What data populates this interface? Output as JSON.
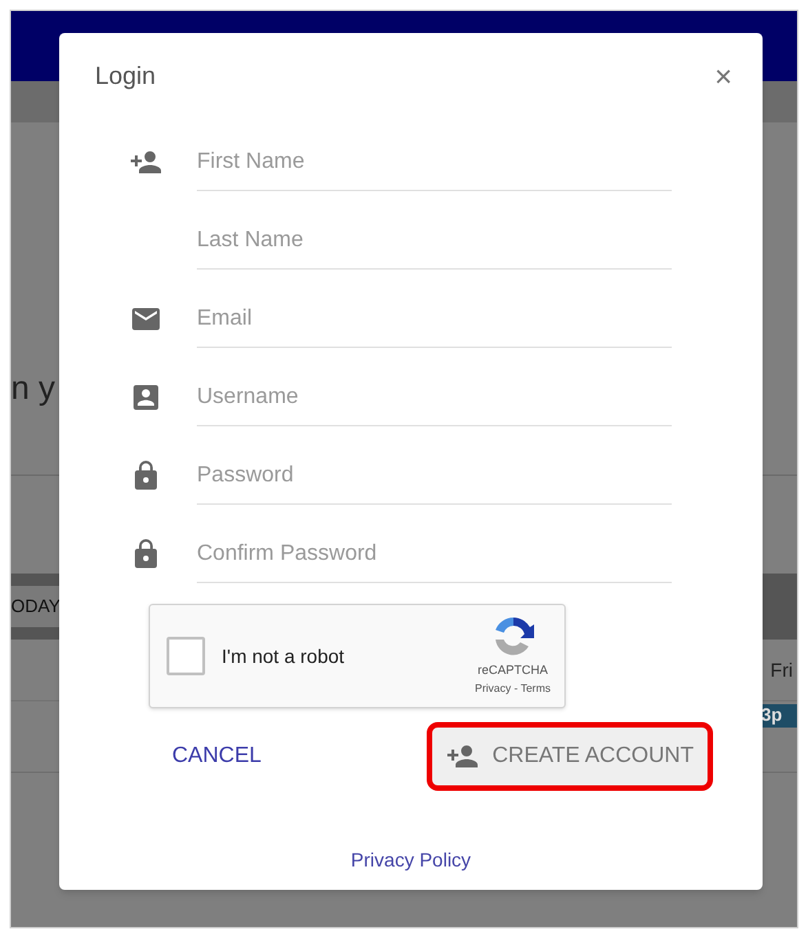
{
  "background": {
    "heading_fragment": "n y",
    "tab_fragment": "ODAY",
    "date_fragment": "Fri",
    "event_fragment": "3p"
  },
  "dialog": {
    "title": "Login",
    "close": "×",
    "fields": [
      {
        "placeholder": "First Name"
      },
      {
        "placeholder": "Last Name"
      },
      {
        "placeholder": "Email"
      },
      {
        "placeholder": "Username"
      },
      {
        "placeholder": "Password"
      },
      {
        "placeholder": "Confirm Password"
      }
    ],
    "captcha": {
      "label": "I'm not a robot",
      "checked": false,
      "brand": "reCAPTCHA",
      "links": "Privacy - Terms"
    },
    "buttons": [
      {
        "label": "CANCEL",
        "kind": "text",
        "highlighted": false
      },
      {
        "label": "CREATE ACCOUNT",
        "kind": "raised",
        "highlighted": true
      }
    ],
    "privacy_link": "Privacy Policy"
  }
}
